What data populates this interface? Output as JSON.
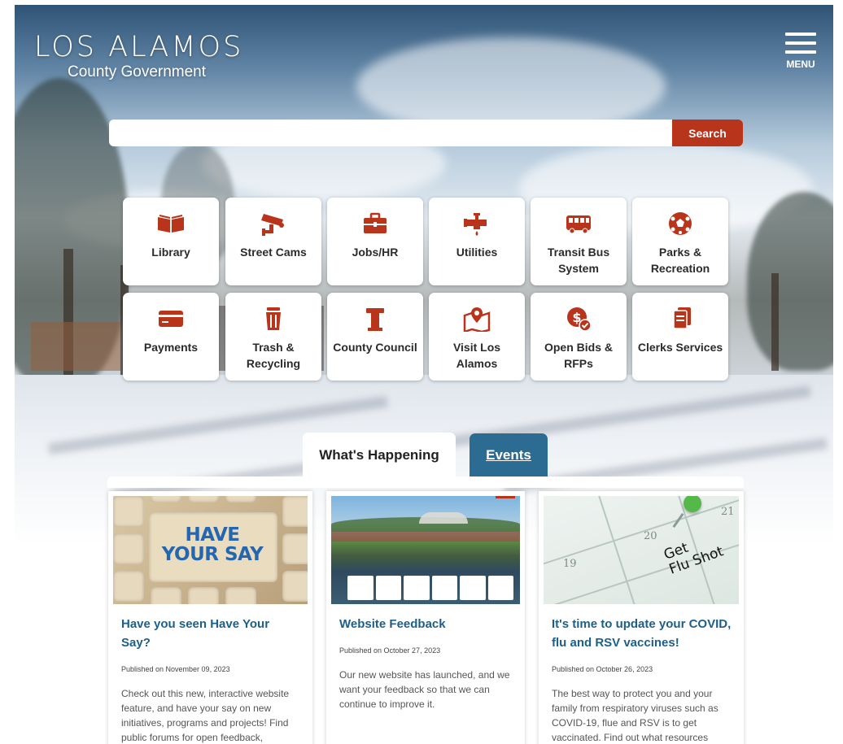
{
  "header": {
    "logo_line1": "LOS ALAMOS",
    "logo_line2": "County Government",
    "menu_label": "MENU"
  },
  "search": {
    "placeholder": "",
    "button_label": "Search"
  },
  "quick_links": [
    {
      "label": "Library",
      "icon": "book-icon"
    },
    {
      "label": "Street Cams",
      "icon": "security-camera-icon"
    },
    {
      "label": "Jobs/HR",
      "icon": "briefcase-icon"
    },
    {
      "label": "Utilities",
      "icon": "water-faucet-icon"
    },
    {
      "label": "Transit Bus System",
      "icon": "bus-icon"
    },
    {
      "label": "Parks & Recreation",
      "icon": "soccer-ball-icon"
    },
    {
      "label": "Payments",
      "icon": "credit-card-icon"
    },
    {
      "label": "Trash & Recycling",
      "icon": "trash-can-icon"
    },
    {
      "label": "County Council",
      "icon": "podium-icon"
    },
    {
      "label": "Visit Los Alamos",
      "icon": "map-pin-icon"
    },
    {
      "label": "Open Bids & RFPs",
      "icon": "bid-dollar-icon"
    },
    {
      "label": "Clerks Services",
      "icon": "documents-icon"
    }
  ],
  "tabs": {
    "whats_happening": "What's Happening",
    "events": "Events"
  },
  "news": [
    {
      "title": "Have you seen Have Your Say?",
      "date": "Published on November 09, 2023",
      "body": "Check out this new, interactive website feature, and have your say on new initiatives, programs and projects! Find public forums for open feedback,",
      "image_text": "HAVE YOUR SAY"
    },
    {
      "title": "Website Feedback",
      "date": "Published on October 27, 2023",
      "body": "Our new website has launched, and we want your feedback so that we can continue to improve it."
    },
    {
      "title": "It's time to update your COVID, flu and RSV vaccines!",
      "date": "Published on October 26, 2023",
      "body": "The best way to protect you and your family from respiratory viruses such as COVID-19, flue and RSV is to get vaccinated. Find out what resources",
      "image_text_line1": "Get",
      "image_text_line2": "Flu Shot",
      "calendar_days": [
        "21",
        "20",
        "19"
      ]
    }
  ],
  "colors": {
    "accent_red": "#b8341b",
    "tab_blue": "#2c6c93",
    "link_blue": "#1d5f89"
  }
}
